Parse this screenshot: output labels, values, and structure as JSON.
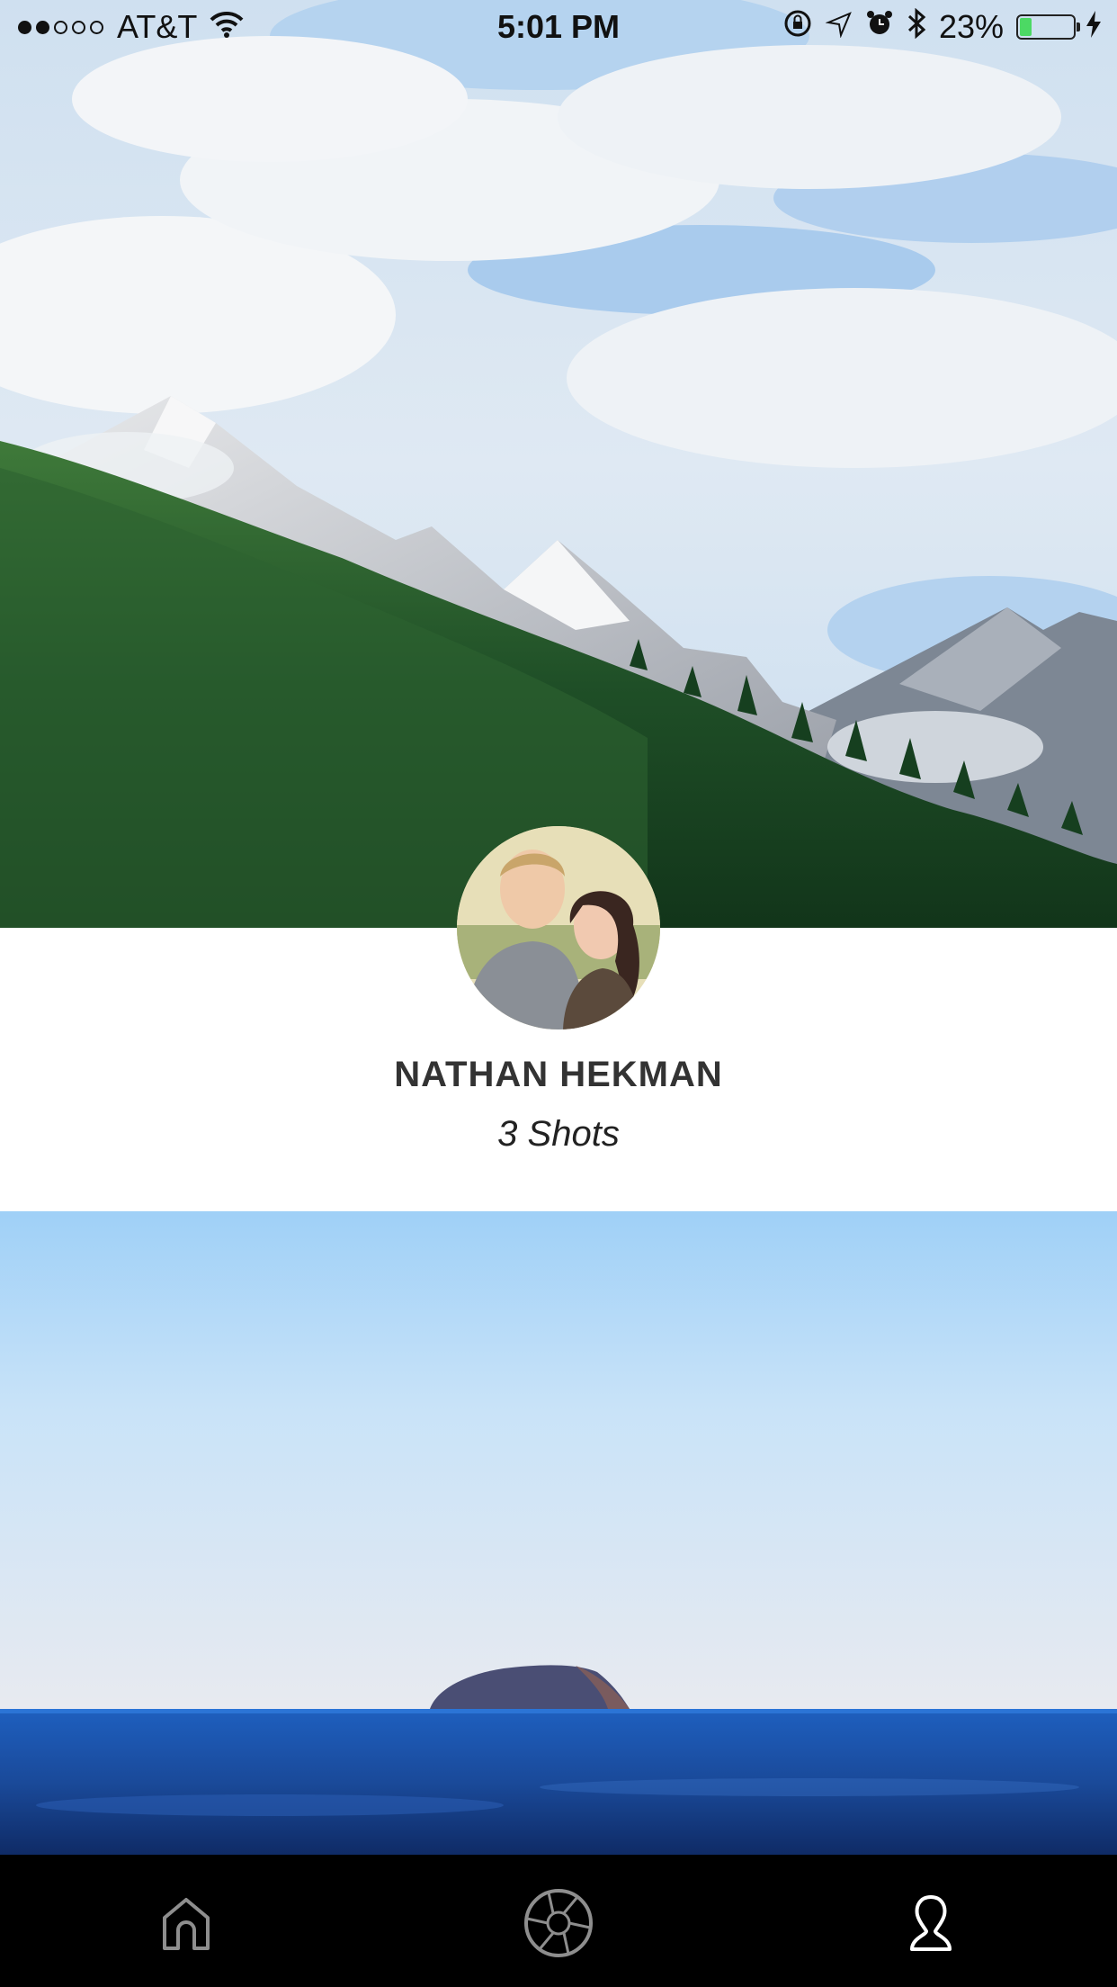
{
  "status_bar": {
    "signal": {
      "filled": 2,
      "total": 5
    },
    "carrier": "AT&T",
    "time": "5:01 PM",
    "battery_text": "23%",
    "battery_level": 0.23,
    "icons": [
      "wifi-icon",
      "orientation-lock-icon",
      "location-icon",
      "alarm-icon",
      "bluetooth-icon",
      "charging-bolt-icon"
    ]
  },
  "profile": {
    "name": "NATHAN HEKMAN",
    "shots": "3 Shots"
  },
  "tab_bar": {
    "items": [
      {
        "name": "home",
        "icon": "home-icon",
        "active": false
      },
      {
        "name": "camera",
        "icon": "aperture-icon",
        "active": false
      },
      {
        "name": "profile",
        "icon": "person-icon",
        "active": true
      }
    ]
  },
  "colors": {
    "sky_top": "#9fd0f7",
    "sea": "#1c4fa3",
    "tab_bar": "#000000",
    "battery_fill": "#4cd964"
  }
}
